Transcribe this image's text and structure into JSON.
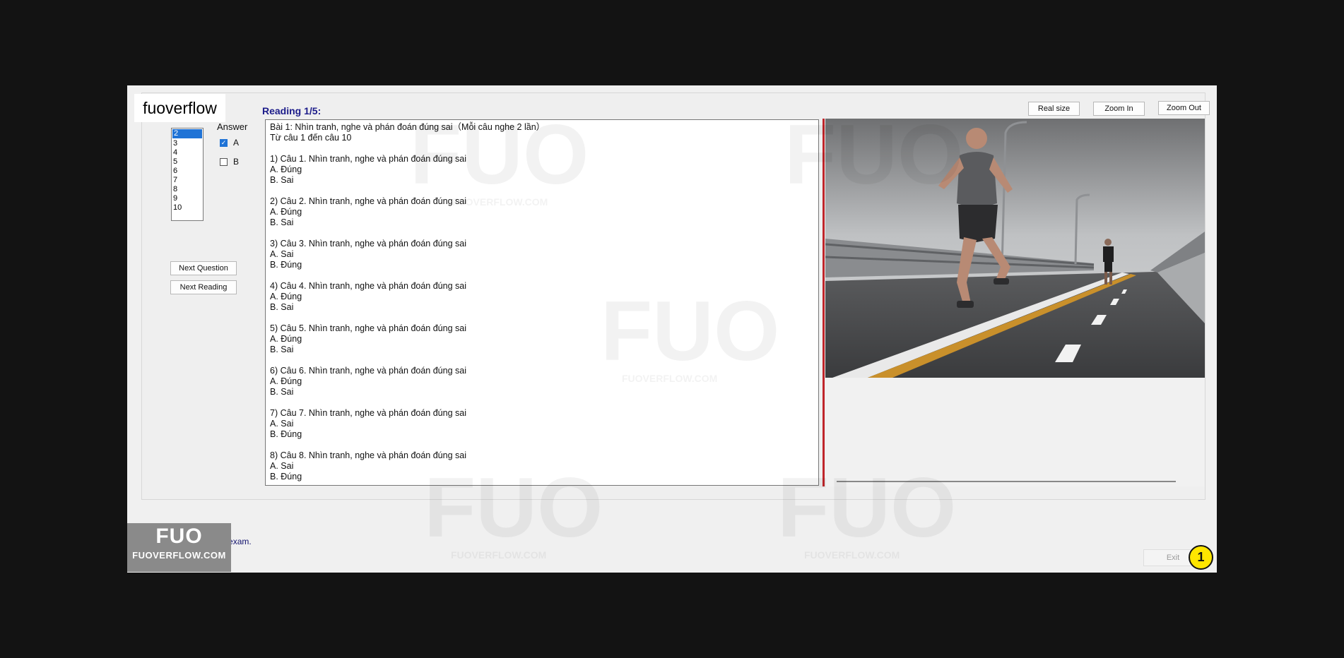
{
  "brand": "fuoverflow",
  "sidebar": {
    "answer_label": "Answer",
    "questions": [
      "2",
      "3",
      "4",
      "5",
      "6",
      "7",
      "8",
      "9",
      "10"
    ],
    "selected": "2",
    "options": [
      {
        "label": "A",
        "checked": true
      },
      {
        "label": "B",
        "checked": false
      }
    ],
    "next_question": "Next Question",
    "next_reading": "Next Reading"
  },
  "reading": {
    "title": "Reading 1/5:",
    "lines": [
      "Bài 1: Nhìn tranh, nghe và phán đoán đúng sai（Mỗi câu nghe 2 lần）",
      "Từ câu 1 đến câu 10",
      "",
      "1) Câu 1. Nhìn tranh, nghe và phán đoán đúng sai",
      "A. Đúng",
      "B. Sai",
      "",
      "2) Câu 2. Nhìn tranh, nghe và phán đoán đúng sai",
      "A. Đúng",
      "B. Sai",
      "",
      "3) Câu 3. Nhìn tranh, nghe và phán đoán đúng sai",
      "A. Sai",
      "B. Đúng",
      "",
      "4) Câu 4. Nhìn tranh, nghe và phán đoán đúng sai",
      "A. Đúng",
      "B. Sai",
      "",
      "5) Câu 5. Nhìn tranh, nghe và phán đoán đúng sai",
      "A. Đúng",
      "B. Sai",
      "",
      "6) Câu 6. Nhìn tranh, nghe và phán đoán đúng sai",
      "A. Đúng",
      "B. Sai",
      "",
      "7) Câu 7. Nhìn tranh, nghe và phán đoán đúng sai",
      "A. Sai",
      "B. Đúng",
      "",
      "8) Câu 8. Nhìn tranh, nghe và phán đoán đúng sai",
      "A. Sai",
      "B. Đúng"
    ]
  },
  "image_toolbar": {
    "real_size": "Real size",
    "zoom_in": "Zoom In",
    "zoom_out": "Zoom Out"
  },
  "footer": {
    "finish_label": "I want to finish the exam.",
    "exit": "Exit",
    "step_number": "1",
    "badge_top": "FUO",
    "badge_bottom": "FUOVERFLOW.COM"
  },
  "watermark": {
    "logo": "FUO",
    "site": "FUOVERFLOW.COM"
  }
}
